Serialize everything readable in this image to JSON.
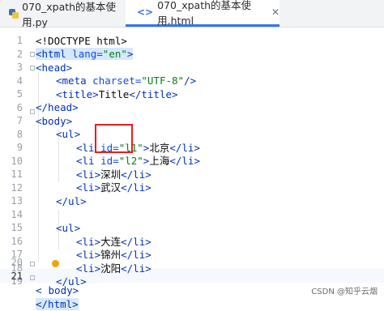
{
  "tabs": [
    {
      "label": "070_xpath的基本使用.py",
      "icon": "python-file-icon",
      "active": false
    },
    {
      "label": "070_xpath的基本使用.html",
      "icon": "html-file-icon",
      "active": true
    }
  ],
  "line_numbers": [
    "1",
    "2",
    "3",
    "4",
    "5",
    "6",
    "7",
    "8",
    "9",
    "10",
    "11",
    "12",
    "13",
    "14",
    "15",
    "16",
    "17",
    "18",
    "19",
    "20",
    "21"
  ],
  "current_line": "21",
  "code": {
    "l1": "<!DOCTYPE html>",
    "l2a": "<html",
    "l2b": " lang=",
    "l2c": "\"en\"",
    "l2d": ">",
    "l3": "<head>",
    "l4a": "<meta",
    "l4b": " charset=",
    "l4c": "\"UTF-8\"",
    "l4d": "/>",
    "l5a": "<title>",
    "l5b": "Title",
    "l5c": "</title>",
    "l6": "</head>",
    "l7": "<body>",
    "l8": "<ul>",
    "l9a": "<li",
    "l9b": " id=",
    "l9c": "\"l1\"",
    "l9d": ">",
    "l9e": "北京",
    "l9f": "</li>",
    "l10a": "<li",
    "l10b": " id=",
    "l10c": "\"l2\"",
    "l10d": ">",
    "l10e": "上海",
    "l10f": "</li>",
    "l11a": "<li>",
    "l11b": "深圳",
    "l11c": "</li>",
    "l12a": "<li>",
    "l12b": "武汉",
    "l12c": "</li>",
    "l13": "</ul>",
    "l15": "<ul>",
    "l16a": "<li>",
    "l16b": "大连",
    "l16c": "</li>",
    "l17a": "<li>",
    "l17b": "锦州",
    "l17c": "</li>",
    "l18a": "<li>",
    "l18b": "沈阳",
    "l18c": "</li>",
    "l19": "</ul>",
    "l20a": "<",
    "l20b": "body>",
    "l21": "</html>"
  },
  "watermark": "CSDN @知乎云烟",
  "colors": {
    "accent": "#3574f0",
    "annotation_box": "#e02020",
    "tag": "#0033b3",
    "string": "#067d17"
  }
}
